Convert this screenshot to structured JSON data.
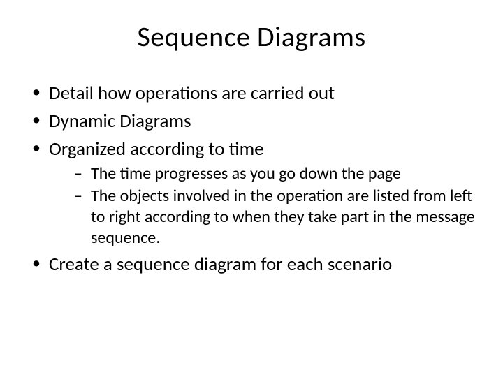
{
  "title": "Sequence Diagrams",
  "bullets": {
    "item1": "Detail how operations are carried out",
    "item2": "Dynamic Diagrams",
    "item3": "Organized according to time",
    "item3_sub1": "The time progresses as you go down the page",
    "item3_sub2": "The objects involved in the operation are listed from left to right according to when they take part in the message sequence.",
    "item4": "Create a sequence diagram for each scenario"
  }
}
